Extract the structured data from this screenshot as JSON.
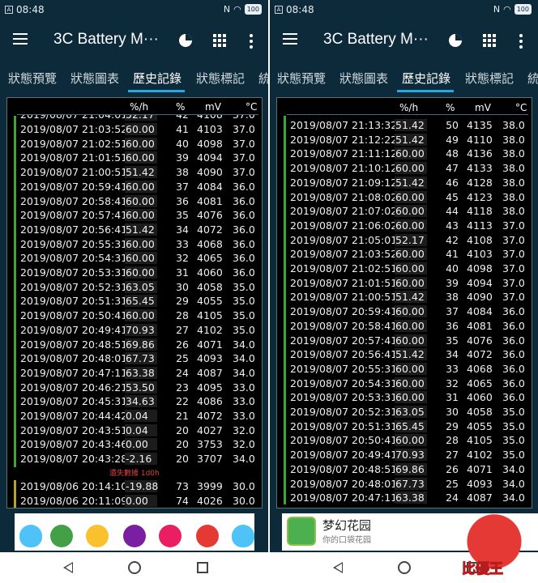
{
  "status_bar": {
    "time": "08:48",
    "battery": "100"
  },
  "app": {
    "title": "3C Battery M···"
  },
  "tabs": [
    "狀態預覽",
    "狀態圖表",
    "歷史記錄",
    "狀態標記",
    "統"
  ],
  "active_tab": "歷史記錄",
  "table_header": {
    "rate": "%/h",
    "pct": "%",
    "mv": "mV",
    "temp": "°C"
  },
  "left_table": {
    "partial_top_row": {
      "date": "2019/08/07 21:04:01",
      "rate": "52.17",
      "pct": "42",
      "mv": "4108",
      "temp": "37.0"
    },
    "rows": [
      {
        "date": "2019/08/07 21:03:52",
        "rate": "60.00",
        "pct": "41",
        "mv": "4103",
        "temp": "37.0"
      },
      {
        "date": "2019/08/07 21:02:51",
        "rate": "60.00",
        "pct": "40",
        "mv": "4098",
        "temp": "37.0"
      },
      {
        "date": "2019/08/07 21:01:51",
        "rate": "60.00",
        "pct": "39",
        "mv": "4094",
        "temp": "37.0"
      },
      {
        "date": "2019/08/07 21:00:51",
        "rate": "51.42",
        "pct": "38",
        "mv": "4090",
        "temp": "37.0"
      },
      {
        "date": "2019/08/07 20:59:41",
        "rate": "60.00",
        "pct": "37",
        "mv": "4084",
        "temp": "36.0"
      },
      {
        "date": "2019/08/07 20:58:41",
        "rate": "60.00",
        "pct": "36",
        "mv": "4081",
        "temp": "36.0"
      },
      {
        "date": "2019/08/07 20:57:41",
        "rate": "60.00",
        "pct": "35",
        "mv": "4076",
        "temp": "36.0"
      },
      {
        "date": "2019/08/07 20:56:41",
        "rate": "51.42",
        "pct": "34",
        "mv": "4072",
        "temp": "36.0"
      },
      {
        "date": "2019/08/07 20:55:31",
        "rate": "60.00",
        "pct": "33",
        "mv": "4068",
        "temp": "36.0"
      },
      {
        "date": "2019/08/07 20:54:31",
        "rate": "60.00",
        "pct": "32",
        "mv": "4065",
        "temp": "36.0"
      },
      {
        "date": "2019/08/07 20:53:31",
        "rate": "60.00",
        "pct": "31",
        "mv": "4060",
        "temp": "36.0"
      },
      {
        "date": "2019/08/07 20:52:31",
        "rate": "63.05",
        "pct": "30",
        "mv": "4058",
        "temp": "35.0"
      },
      {
        "date": "2019/08/07 20:51:31",
        "rate": "65.45",
        "pct": "29",
        "mv": "4055",
        "temp": "35.0"
      },
      {
        "date": "2019/08/07 20:50:41",
        "rate": "60.00",
        "pct": "28",
        "mv": "4105",
        "temp": "35.0"
      },
      {
        "date": "2019/08/07 20:49:41",
        "rate": "70.93",
        "pct": "27",
        "mv": "4102",
        "temp": "35.0"
      },
      {
        "date": "2019/08/07 20:48:51",
        "rate": "69.86",
        "pct": "26",
        "mv": "4071",
        "temp": "34.0"
      },
      {
        "date": "2019/08/07 20:48:01",
        "rate": "67.73",
        "pct": "25",
        "mv": "4093",
        "temp": "34.0"
      },
      {
        "date": "2019/08/07 20:47:11",
        "rate": "63.38",
        "pct": "24",
        "mv": "4087",
        "temp": "34.0"
      },
      {
        "date": "2019/08/07 20:46:21",
        "rate": "53.50",
        "pct": "23",
        "mv": "4095",
        "temp": "33.0"
      },
      {
        "date": "2019/08/07 20:45:31",
        "rate": "34.63",
        "pct": "22",
        "mv": "4086",
        "temp": "33.0"
      },
      {
        "date": "2019/08/07 20:44:42",
        "rate": "0.04",
        "pct": "21",
        "mv": "4072",
        "temp": "33.0"
      },
      {
        "date": "2019/08/07 20:43:51",
        "rate": "0.04",
        "pct": "20",
        "mv": "4027",
        "temp": "32.0"
      },
      {
        "date": "2019/08/07 20:43:46",
        "rate": "0.00",
        "pct": "20",
        "mv": "3753",
        "temp": "32.0"
      },
      {
        "date": "2019/08/07 20:43:28",
        "rate": "-2.16",
        "pct": "20",
        "mv": "3707",
        "temp": "34.0"
      }
    ],
    "lost_data_label": "遺失數據 1d0h",
    "rows_after": [
      {
        "date": "2019/08/06 20:14:10",
        "rate": "-19.88",
        "pct": "73",
        "mv": "3999",
        "temp": "30.0"
      },
      {
        "date": "2019/08/06 20:11:09",
        "rate": "0.00",
        "pct": "74",
        "mv": "4026",
        "temp": "30.0"
      }
    ]
  },
  "right_table": {
    "rows": [
      {
        "date": "2019/08/07 21:13:32",
        "rate": "51.42",
        "pct": "50",
        "mv": "4135",
        "temp": "38.0"
      },
      {
        "date": "2019/08/07 21:12:22",
        "rate": "51.42",
        "pct": "49",
        "mv": "4110",
        "temp": "38.0"
      },
      {
        "date": "2019/08/07 21:11:12",
        "rate": "60.00",
        "pct": "48",
        "mv": "4136",
        "temp": "38.0"
      },
      {
        "date": "2019/08/07 21:10:12",
        "rate": "60.00",
        "pct": "47",
        "mv": "4133",
        "temp": "38.0"
      },
      {
        "date": "2019/08/07 21:09:12",
        "rate": "51.42",
        "pct": "46",
        "mv": "4128",
        "temp": "38.0"
      },
      {
        "date": "2019/08/07 21:08:02",
        "rate": "60.00",
        "pct": "45",
        "mv": "4123",
        "temp": "38.0"
      },
      {
        "date": "2019/08/07 21:07:02",
        "rate": "60.00",
        "pct": "44",
        "mv": "4118",
        "temp": "38.0"
      },
      {
        "date": "2019/08/07 21:06:02",
        "rate": "60.00",
        "pct": "43",
        "mv": "4113",
        "temp": "37.0"
      },
      {
        "date": "2019/08/07 21:05:01",
        "rate": "52.17",
        "pct": "42",
        "mv": "4108",
        "temp": "37.0"
      },
      {
        "date": "2019/08/07 21:03:52",
        "rate": "60.00",
        "pct": "41",
        "mv": "4103",
        "temp": "37.0"
      },
      {
        "date": "2019/08/07 21:02:51",
        "rate": "60.00",
        "pct": "40",
        "mv": "4098",
        "temp": "37.0"
      },
      {
        "date": "2019/08/07 21:01:51",
        "rate": "60.00",
        "pct": "39",
        "mv": "4094",
        "temp": "37.0"
      },
      {
        "date": "2019/08/07 21:00:51",
        "rate": "51.42",
        "pct": "38",
        "mv": "4090",
        "temp": "37.0"
      },
      {
        "date": "2019/08/07 20:59:41",
        "rate": "60.00",
        "pct": "37",
        "mv": "4084",
        "temp": "36.0"
      },
      {
        "date": "2019/08/07 20:58:41",
        "rate": "60.00",
        "pct": "36",
        "mv": "4081",
        "temp": "36.0"
      },
      {
        "date": "2019/08/07 20:57:41",
        "rate": "60.00",
        "pct": "35",
        "mv": "4076",
        "temp": "36.0"
      },
      {
        "date": "2019/08/07 20:56:41",
        "rate": "51.42",
        "pct": "34",
        "mv": "4072",
        "temp": "36.0"
      },
      {
        "date": "2019/08/07 20:55:31",
        "rate": "60.00",
        "pct": "33",
        "mv": "4068",
        "temp": "36.0"
      },
      {
        "date": "2019/08/07 20:54:31",
        "rate": "60.00",
        "pct": "32",
        "mv": "4065",
        "temp": "36.0"
      },
      {
        "date": "2019/08/07 20:53:31",
        "rate": "60.00",
        "pct": "31",
        "mv": "4060",
        "temp": "36.0"
      },
      {
        "date": "2019/08/07 20:52:31",
        "rate": "63.05",
        "pct": "30",
        "mv": "4058",
        "temp": "35.0"
      },
      {
        "date": "2019/08/07 20:51:31",
        "rate": "65.45",
        "pct": "29",
        "mv": "4055",
        "temp": "35.0"
      },
      {
        "date": "2019/08/07 20:50:41",
        "rate": "60.00",
        "pct": "28",
        "mv": "4105",
        "temp": "35.0"
      },
      {
        "date": "2019/08/07 20:49:41",
        "rate": "70.93",
        "pct": "27",
        "mv": "4102",
        "temp": "35.0"
      },
      {
        "date": "2019/08/07 20:48:51",
        "rate": "69.86",
        "pct": "26",
        "mv": "4071",
        "temp": "34.0"
      },
      {
        "date": "2019/08/07 20:48:01",
        "rate": "67.73",
        "pct": "25",
        "mv": "4093",
        "temp": "34.0"
      },
      {
        "date": "2019/08/07 20:47:11",
        "rate": "63.38",
        "pct": "24",
        "mv": "4087",
        "temp": "34.0"
      }
    ]
  },
  "ad_right": {
    "title": "梦幻花园",
    "subtitle": "你的口袋花园"
  },
  "watermark": {
    "text": "比優王"
  },
  "colors": {
    "charging_bar": "#3fa535",
    "lost_bar": "#b8a32a",
    "tab_indicator": "#26a9e0",
    "background": "#0c2a3a",
    "lost_label": "#e04040"
  },
  "icons": [
    "menu-icon",
    "pie-chart-icon",
    "grid-apps-icon",
    "more-vert-icon",
    "wifi-icon",
    "nfc-icon",
    "back-icon",
    "home-icon",
    "recents-icon"
  ]
}
